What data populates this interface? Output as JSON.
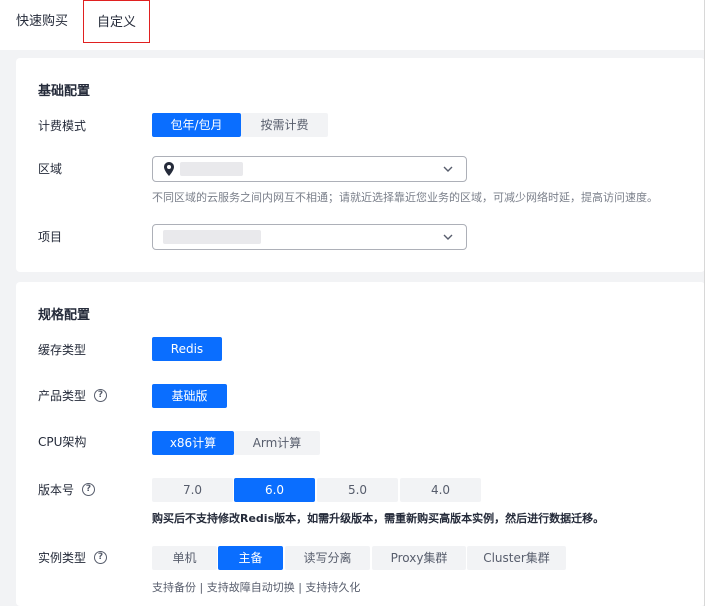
{
  "tabs": {
    "quick": "快速购买",
    "custom": "自定义"
  },
  "basic": {
    "title": "基础配置",
    "billing": {
      "label": "计费模式",
      "options": [
        "包年/包月",
        "按需计费"
      ]
    },
    "region": {
      "label": "区域",
      "hint": "不同区域的云服务之间内网互不相通；请就近选择靠近您业务的区域，可减少网络时延，提高访问速度。"
    },
    "project": {
      "label": "项目"
    }
  },
  "spec": {
    "title": "规格配置",
    "cache_type": {
      "label": "缓存类型",
      "options": [
        "Redis"
      ]
    },
    "product_type": {
      "label": "产品类型",
      "options": [
        "基础版"
      ]
    },
    "cpu": {
      "label": "CPU架构",
      "options": [
        "x86计算",
        "Arm计算"
      ]
    },
    "version": {
      "label": "版本号",
      "options": [
        "7.0",
        "6.0",
        "5.0",
        "4.0"
      ],
      "warning": "购买后不支持修改Redis版本，如需升级版本，需重新购买高版本实例，然后进行数据迁移。"
    },
    "instance_type": {
      "label": "实例类型",
      "options": [
        "单机",
        "主备",
        "读写分离",
        "Proxy集群",
        "Cluster集群"
      ],
      "desc": "支持备份 | 支持故障自动切换 | 支持持久化"
    },
    "help_symbol": "?"
  },
  "colors": {
    "accent": "#0a6eff",
    "tab_border": "#e02020"
  }
}
